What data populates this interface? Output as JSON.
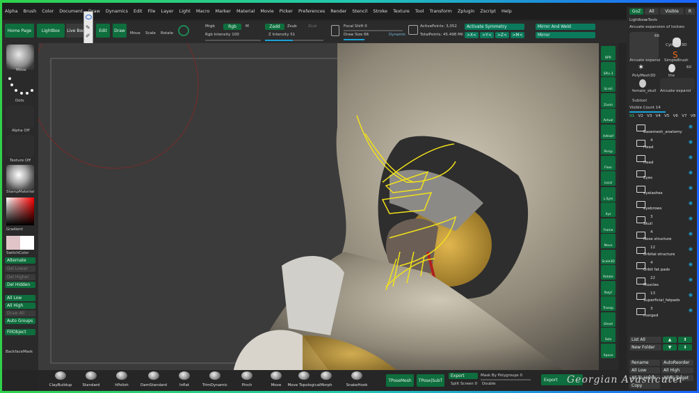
{
  "menu": [
    "Alpha",
    "Brush",
    "Color",
    "Document",
    "Draw",
    "Dynamics",
    "Edit",
    "File",
    "Layer",
    "Light",
    "Macro",
    "Marker",
    "Material",
    "Movie",
    "Picker",
    "Preferences",
    "Render",
    "Stencil",
    "Stroke",
    "Texture",
    "Tool",
    "Transform",
    "Zplugin",
    "Zscript",
    "Help"
  ],
  "top_right_menu": {
    "goz": "GoZ",
    "all": "All",
    "visible": "Visible",
    "r": "R"
  },
  "topbar": {
    "home": "Home Page",
    "lightbox": "LightBox",
    "live": "Live Boo",
    "edit": "Edit",
    "draw": "Draw",
    "move": "Move",
    "scale": "Scale",
    "rotate": "Rotate",
    "mrgb": "Mrgb",
    "rgb": "Rgb",
    "m": "M",
    "rgb_intensity": "Rgb Intensity 100",
    "zadd": "Zadd",
    "zsub": "Zsub",
    "zcut": "Zcut",
    "z_intensity": "Z Intensity 51",
    "focal_shift": "Focal Shift 0",
    "draw_size": "Draw Size 66",
    "dynamic": "Dynamic",
    "active_points": "ActivePoints: 3,052",
    "total_points": "TotalPoints: 45.498 Mil",
    "activate_symmetry": "Activate Symmetry",
    "x": ">X<",
    "y": ">Y<",
    "z": ">Z<",
    "m_sym": ">M<",
    "mirror_weld": "Mirror And Weld",
    "mirror": "Mirror"
  },
  "left": {
    "move": "Move",
    "dots": "Dots",
    "alpha_off": "Alpha Off",
    "texture_off": "Texture Off",
    "material": "StampMaterial",
    "gradient": "Gradient",
    "switch_color": "SwitchColor",
    "alternate": "Alternate",
    "del_lower": "Del Lower",
    "del_higher": "Del Higher",
    "del_hidden": "Del Hidden",
    "all_low": "All Low",
    "all_high": "All High",
    "draw_all": "Draw All",
    "auto_groups": "Auto Groups",
    "fill_object": "FillObject",
    "backface": "BackfaceMask"
  },
  "right_tray": [
    "BPR",
    "SPix 3",
    "Scroll",
    "Zoom",
    "Actual",
    "AAHalf",
    "Persp",
    "Floor",
    "Local",
    "L.Sym",
    "Xyz",
    "Frame",
    "Move",
    "Scale3D",
    "Rotate",
    "PolyF",
    "Transp",
    "Ghost",
    "Solo",
    "Xpose"
  ],
  "panel": {
    "lightbox_tools": "Lightbox▸Tools",
    "arcuate_1": "Arcuate expansion of lockwo",
    "count_66a": "66",
    "cylinder": "Cylinder3D",
    "simplebrush": "SimpleBrush",
    "arcuate_2": "Arcuate expansi",
    "polymesh": "PolyMesh3D",
    "the": "the",
    "count_60": "60",
    "female_skull": "female_skull",
    "arcuate_3": "Arcuate expansi",
    "subtool": "Subtool",
    "visible_count": "Visible Count 14",
    "versions": [
      "V1",
      "V2",
      "V3",
      "V4",
      "V5",
      "V6",
      "V7",
      "V8"
    ],
    "items": [
      {
        "name": "Basemesh_anatomy",
        "count": ""
      },
      {
        "name": "Head",
        "count": "4"
      },
      {
        "name": "Head",
        "count": ""
      },
      {
        "name": "Eyes",
        "count": ""
      },
      {
        "name": "eyelashes",
        "count": ""
      },
      {
        "name": "eyebrows",
        "count": ""
      },
      {
        "name": "Skull",
        "count": "3"
      },
      {
        "name": "Nose structure",
        "count": "4"
      },
      {
        "name": "Orbital structure",
        "count": "12"
      },
      {
        "name": "Orbit fat pads",
        "count": "4"
      },
      {
        "name": "Muscles",
        "count": "22"
      },
      {
        "name": "Superficial_fatpads",
        "count": "13"
      },
      {
        "name": "merged",
        "count": "3"
      }
    ],
    "list_all": "List All",
    "new_folder": "New Folder",
    "rename": "Rename",
    "auto_reorder": "AutoReorder",
    "all_low": "All Low",
    "all_high": "All High",
    "all_to_home": "All To Home",
    "all_to_target": "All To Target",
    "copy": "Copy"
  },
  "bottom": {
    "brushes": [
      "ClayBuildup",
      "Standard",
      "hPolish",
      "DamStandard",
      "Inflat",
      "TrimDynamic",
      "Pinch",
      "Move",
      "Move Topological",
      "Morph",
      "SnakeHook"
    ],
    "tposemesh": "TPoseMesh",
    "tpose_subt": "TPose|SubT",
    "export": "Export",
    "mask_polygroups": "Mask By Polygroups 0",
    "split_screen": "Split Screen 0",
    "double": "Double",
    "export2": "Export"
  },
  "watermark": "Georgian Avasilcutei",
  "colors": {
    "accent": "#0e6e3d",
    "sketch": "#f2e21a",
    "bg": "#252525"
  }
}
